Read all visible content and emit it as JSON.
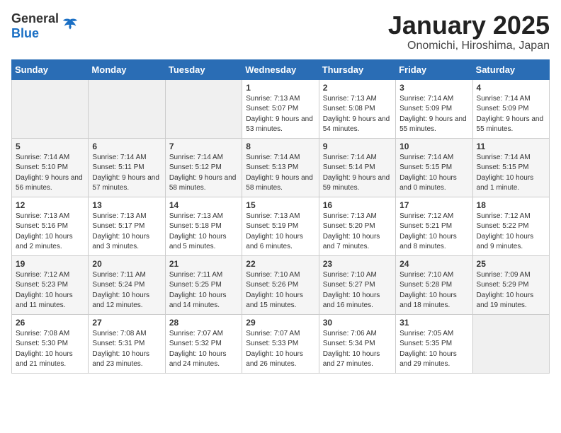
{
  "logo": {
    "general": "General",
    "blue": "Blue"
  },
  "title": {
    "month_year": "January 2025",
    "location": "Onomichi, Hiroshima, Japan"
  },
  "days_of_week": [
    "Sunday",
    "Monday",
    "Tuesday",
    "Wednesday",
    "Thursday",
    "Friday",
    "Saturday"
  ],
  "weeks": [
    [
      {
        "day": "",
        "content": ""
      },
      {
        "day": "",
        "content": ""
      },
      {
        "day": "",
        "content": ""
      },
      {
        "day": "1",
        "content": "Sunrise: 7:13 AM\nSunset: 5:07 PM\nDaylight: 9 hours and 53 minutes."
      },
      {
        "day": "2",
        "content": "Sunrise: 7:13 AM\nSunset: 5:08 PM\nDaylight: 9 hours and 54 minutes."
      },
      {
        "day": "3",
        "content": "Sunrise: 7:14 AM\nSunset: 5:09 PM\nDaylight: 9 hours and 55 minutes."
      },
      {
        "day": "4",
        "content": "Sunrise: 7:14 AM\nSunset: 5:09 PM\nDaylight: 9 hours and 55 minutes."
      }
    ],
    [
      {
        "day": "5",
        "content": "Sunrise: 7:14 AM\nSunset: 5:10 PM\nDaylight: 9 hours and 56 minutes."
      },
      {
        "day": "6",
        "content": "Sunrise: 7:14 AM\nSunset: 5:11 PM\nDaylight: 9 hours and 57 minutes."
      },
      {
        "day": "7",
        "content": "Sunrise: 7:14 AM\nSunset: 5:12 PM\nDaylight: 9 hours and 58 minutes."
      },
      {
        "day": "8",
        "content": "Sunrise: 7:14 AM\nSunset: 5:13 PM\nDaylight: 9 hours and 58 minutes."
      },
      {
        "day": "9",
        "content": "Sunrise: 7:14 AM\nSunset: 5:14 PM\nDaylight: 9 hours and 59 minutes."
      },
      {
        "day": "10",
        "content": "Sunrise: 7:14 AM\nSunset: 5:15 PM\nDaylight: 10 hours and 0 minutes."
      },
      {
        "day": "11",
        "content": "Sunrise: 7:14 AM\nSunset: 5:15 PM\nDaylight: 10 hours and 1 minute."
      }
    ],
    [
      {
        "day": "12",
        "content": "Sunrise: 7:13 AM\nSunset: 5:16 PM\nDaylight: 10 hours and 2 minutes."
      },
      {
        "day": "13",
        "content": "Sunrise: 7:13 AM\nSunset: 5:17 PM\nDaylight: 10 hours and 3 minutes."
      },
      {
        "day": "14",
        "content": "Sunrise: 7:13 AM\nSunset: 5:18 PM\nDaylight: 10 hours and 5 minutes."
      },
      {
        "day": "15",
        "content": "Sunrise: 7:13 AM\nSunset: 5:19 PM\nDaylight: 10 hours and 6 minutes."
      },
      {
        "day": "16",
        "content": "Sunrise: 7:13 AM\nSunset: 5:20 PM\nDaylight: 10 hours and 7 minutes."
      },
      {
        "day": "17",
        "content": "Sunrise: 7:12 AM\nSunset: 5:21 PM\nDaylight: 10 hours and 8 minutes."
      },
      {
        "day": "18",
        "content": "Sunrise: 7:12 AM\nSunset: 5:22 PM\nDaylight: 10 hours and 9 minutes."
      }
    ],
    [
      {
        "day": "19",
        "content": "Sunrise: 7:12 AM\nSunset: 5:23 PM\nDaylight: 10 hours and 11 minutes."
      },
      {
        "day": "20",
        "content": "Sunrise: 7:11 AM\nSunset: 5:24 PM\nDaylight: 10 hours and 12 minutes."
      },
      {
        "day": "21",
        "content": "Sunrise: 7:11 AM\nSunset: 5:25 PM\nDaylight: 10 hours and 14 minutes."
      },
      {
        "day": "22",
        "content": "Sunrise: 7:10 AM\nSunset: 5:26 PM\nDaylight: 10 hours and 15 minutes."
      },
      {
        "day": "23",
        "content": "Sunrise: 7:10 AM\nSunset: 5:27 PM\nDaylight: 10 hours and 16 minutes."
      },
      {
        "day": "24",
        "content": "Sunrise: 7:10 AM\nSunset: 5:28 PM\nDaylight: 10 hours and 18 minutes."
      },
      {
        "day": "25",
        "content": "Sunrise: 7:09 AM\nSunset: 5:29 PM\nDaylight: 10 hours and 19 minutes."
      }
    ],
    [
      {
        "day": "26",
        "content": "Sunrise: 7:08 AM\nSunset: 5:30 PM\nDaylight: 10 hours and 21 minutes."
      },
      {
        "day": "27",
        "content": "Sunrise: 7:08 AM\nSunset: 5:31 PM\nDaylight: 10 hours and 23 minutes."
      },
      {
        "day": "28",
        "content": "Sunrise: 7:07 AM\nSunset: 5:32 PM\nDaylight: 10 hours and 24 minutes."
      },
      {
        "day": "29",
        "content": "Sunrise: 7:07 AM\nSunset: 5:33 PM\nDaylight: 10 hours and 26 minutes."
      },
      {
        "day": "30",
        "content": "Sunrise: 7:06 AM\nSunset: 5:34 PM\nDaylight: 10 hours and 27 minutes."
      },
      {
        "day": "31",
        "content": "Sunrise: 7:05 AM\nSunset: 5:35 PM\nDaylight: 10 hours and 29 minutes."
      },
      {
        "day": "",
        "content": ""
      }
    ]
  ]
}
